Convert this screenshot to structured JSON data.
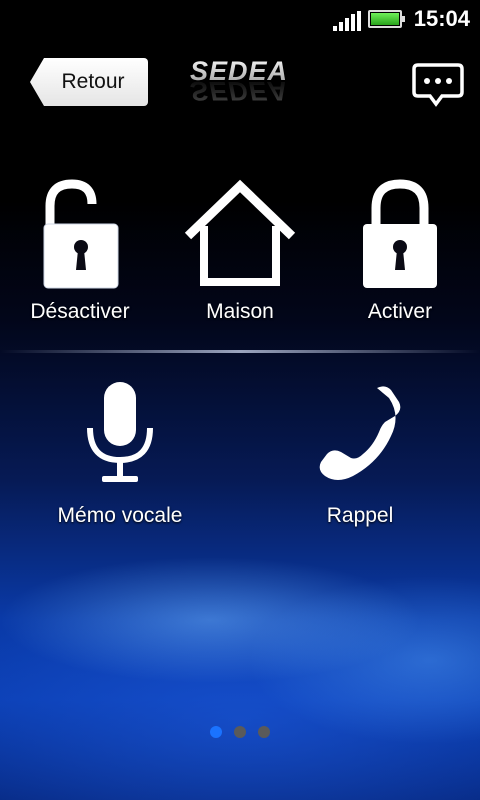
{
  "status_bar": {
    "time": "15:04",
    "signal_icon": "signal-bars-icon",
    "battery_icon": "battery-icon",
    "battery_color": "#3fd12a"
  },
  "header": {
    "back_label": "Retour",
    "logo_text": "SEDEA",
    "chat_icon": "chat-bubble-icon"
  },
  "actions_row1": [
    {
      "label": "Désactiver",
      "icon": "unlocked-padlock-icon"
    },
    {
      "label": "Maison",
      "icon": "house-icon"
    },
    {
      "label": "Activer",
      "icon": "locked-padlock-icon"
    }
  ],
  "actions_row2": [
    {
      "label": "Mémo vocale",
      "icon": "microphone-icon"
    },
    {
      "label": "Rappel",
      "icon": "phone-icon"
    }
  ],
  "pager": {
    "pages": 3,
    "current": 1,
    "active_color": "#1a73ff"
  }
}
